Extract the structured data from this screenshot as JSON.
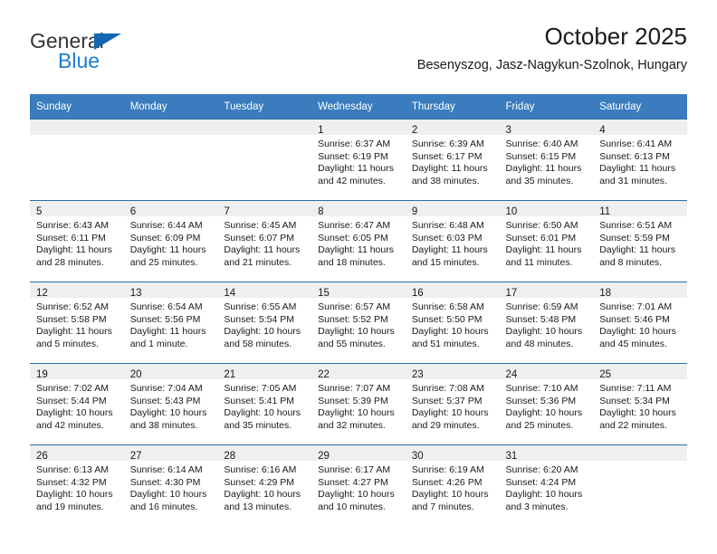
{
  "logo": {
    "general_text": "General",
    "blue_text": "Blue",
    "accent_color": "#1268b3"
  },
  "header": {
    "title": "October 2025",
    "subtitle": "Besenyszog, Jasz-Nagykun-Szolnok, Hungary"
  },
  "theme": {
    "header_blue": "#3a7cbe",
    "divider_blue": "#2d6ca8",
    "daynum_strip": "#efefef"
  },
  "weekday_headers": [
    "Sunday",
    "Monday",
    "Tuesday",
    "Wednesday",
    "Thursday",
    "Friday",
    "Saturday"
  ],
  "labels": {
    "sunrise_prefix": "Sunrise:",
    "sunset_prefix": "Sunset:",
    "daylight_prefix": "Daylight:"
  },
  "weeks": [
    [
      {
        "day": "",
        "empty": true
      },
      {
        "day": "",
        "empty": true
      },
      {
        "day": "",
        "empty": true
      },
      {
        "day": "1",
        "sunrise": "Sunrise: 6:37 AM",
        "sunset": "Sunset: 6:19 PM",
        "daylight": "Daylight: 11 hours and 42 minutes."
      },
      {
        "day": "2",
        "sunrise": "Sunrise: 6:39 AM",
        "sunset": "Sunset: 6:17 PM",
        "daylight": "Daylight: 11 hours and 38 minutes."
      },
      {
        "day": "3",
        "sunrise": "Sunrise: 6:40 AM",
        "sunset": "Sunset: 6:15 PM",
        "daylight": "Daylight: 11 hours and 35 minutes."
      },
      {
        "day": "4",
        "sunrise": "Sunrise: 6:41 AM",
        "sunset": "Sunset: 6:13 PM",
        "daylight": "Daylight: 11 hours and 31 minutes."
      }
    ],
    [
      {
        "day": "5",
        "sunrise": "Sunrise: 6:43 AM",
        "sunset": "Sunset: 6:11 PM",
        "daylight": "Daylight: 11 hours and 28 minutes."
      },
      {
        "day": "6",
        "sunrise": "Sunrise: 6:44 AM",
        "sunset": "Sunset: 6:09 PM",
        "daylight": "Daylight: 11 hours and 25 minutes."
      },
      {
        "day": "7",
        "sunrise": "Sunrise: 6:45 AM",
        "sunset": "Sunset: 6:07 PM",
        "daylight": "Daylight: 11 hours and 21 minutes."
      },
      {
        "day": "8",
        "sunrise": "Sunrise: 6:47 AM",
        "sunset": "Sunset: 6:05 PM",
        "daylight": "Daylight: 11 hours and 18 minutes."
      },
      {
        "day": "9",
        "sunrise": "Sunrise: 6:48 AM",
        "sunset": "Sunset: 6:03 PM",
        "daylight": "Daylight: 11 hours and 15 minutes."
      },
      {
        "day": "10",
        "sunrise": "Sunrise: 6:50 AM",
        "sunset": "Sunset: 6:01 PM",
        "daylight": "Daylight: 11 hours and 11 minutes."
      },
      {
        "day": "11",
        "sunrise": "Sunrise: 6:51 AM",
        "sunset": "Sunset: 5:59 PM",
        "daylight": "Daylight: 11 hours and 8 minutes."
      }
    ],
    [
      {
        "day": "12",
        "sunrise": "Sunrise: 6:52 AM",
        "sunset": "Sunset: 5:58 PM",
        "daylight": "Daylight: 11 hours and 5 minutes."
      },
      {
        "day": "13",
        "sunrise": "Sunrise: 6:54 AM",
        "sunset": "Sunset: 5:56 PM",
        "daylight": "Daylight: 11 hours and 1 minute."
      },
      {
        "day": "14",
        "sunrise": "Sunrise: 6:55 AM",
        "sunset": "Sunset: 5:54 PM",
        "daylight": "Daylight: 10 hours and 58 minutes."
      },
      {
        "day": "15",
        "sunrise": "Sunrise: 6:57 AM",
        "sunset": "Sunset: 5:52 PM",
        "daylight": "Daylight: 10 hours and 55 minutes."
      },
      {
        "day": "16",
        "sunrise": "Sunrise: 6:58 AM",
        "sunset": "Sunset: 5:50 PM",
        "daylight": "Daylight: 10 hours and 51 minutes."
      },
      {
        "day": "17",
        "sunrise": "Sunrise: 6:59 AM",
        "sunset": "Sunset: 5:48 PM",
        "daylight": "Daylight: 10 hours and 48 minutes."
      },
      {
        "day": "18",
        "sunrise": "Sunrise: 7:01 AM",
        "sunset": "Sunset: 5:46 PM",
        "daylight": "Daylight: 10 hours and 45 minutes."
      }
    ],
    [
      {
        "day": "19",
        "sunrise": "Sunrise: 7:02 AM",
        "sunset": "Sunset: 5:44 PM",
        "daylight": "Daylight: 10 hours and 42 minutes."
      },
      {
        "day": "20",
        "sunrise": "Sunrise: 7:04 AM",
        "sunset": "Sunset: 5:43 PM",
        "daylight": "Daylight: 10 hours and 38 minutes."
      },
      {
        "day": "21",
        "sunrise": "Sunrise: 7:05 AM",
        "sunset": "Sunset: 5:41 PM",
        "daylight": "Daylight: 10 hours and 35 minutes."
      },
      {
        "day": "22",
        "sunrise": "Sunrise: 7:07 AM",
        "sunset": "Sunset: 5:39 PM",
        "daylight": "Daylight: 10 hours and 32 minutes."
      },
      {
        "day": "23",
        "sunrise": "Sunrise: 7:08 AM",
        "sunset": "Sunset: 5:37 PM",
        "daylight": "Daylight: 10 hours and 29 minutes."
      },
      {
        "day": "24",
        "sunrise": "Sunrise: 7:10 AM",
        "sunset": "Sunset: 5:36 PM",
        "daylight": "Daylight: 10 hours and 25 minutes."
      },
      {
        "day": "25",
        "sunrise": "Sunrise: 7:11 AM",
        "sunset": "Sunset: 5:34 PM",
        "daylight": "Daylight: 10 hours and 22 minutes."
      }
    ],
    [
      {
        "day": "26",
        "sunrise": "Sunrise: 6:13 AM",
        "sunset": "Sunset: 4:32 PM",
        "daylight": "Daylight: 10 hours and 19 minutes."
      },
      {
        "day": "27",
        "sunrise": "Sunrise: 6:14 AM",
        "sunset": "Sunset: 4:30 PM",
        "daylight": "Daylight: 10 hours and 16 minutes."
      },
      {
        "day": "28",
        "sunrise": "Sunrise: 6:16 AM",
        "sunset": "Sunset: 4:29 PM",
        "daylight": "Daylight: 10 hours and 13 minutes."
      },
      {
        "day": "29",
        "sunrise": "Sunrise: 6:17 AM",
        "sunset": "Sunset: 4:27 PM",
        "daylight": "Daylight: 10 hours and 10 minutes."
      },
      {
        "day": "30",
        "sunrise": "Sunrise: 6:19 AM",
        "sunset": "Sunset: 4:26 PM",
        "daylight": "Daylight: 10 hours and 7 minutes."
      },
      {
        "day": "31",
        "sunrise": "Sunrise: 6:20 AM",
        "sunset": "Sunset: 4:24 PM",
        "daylight": "Daylight: 10 hours and 3 minutes."
      },
      {
        "day": "",
        "empty": true
      }
    ]
  ]
}
